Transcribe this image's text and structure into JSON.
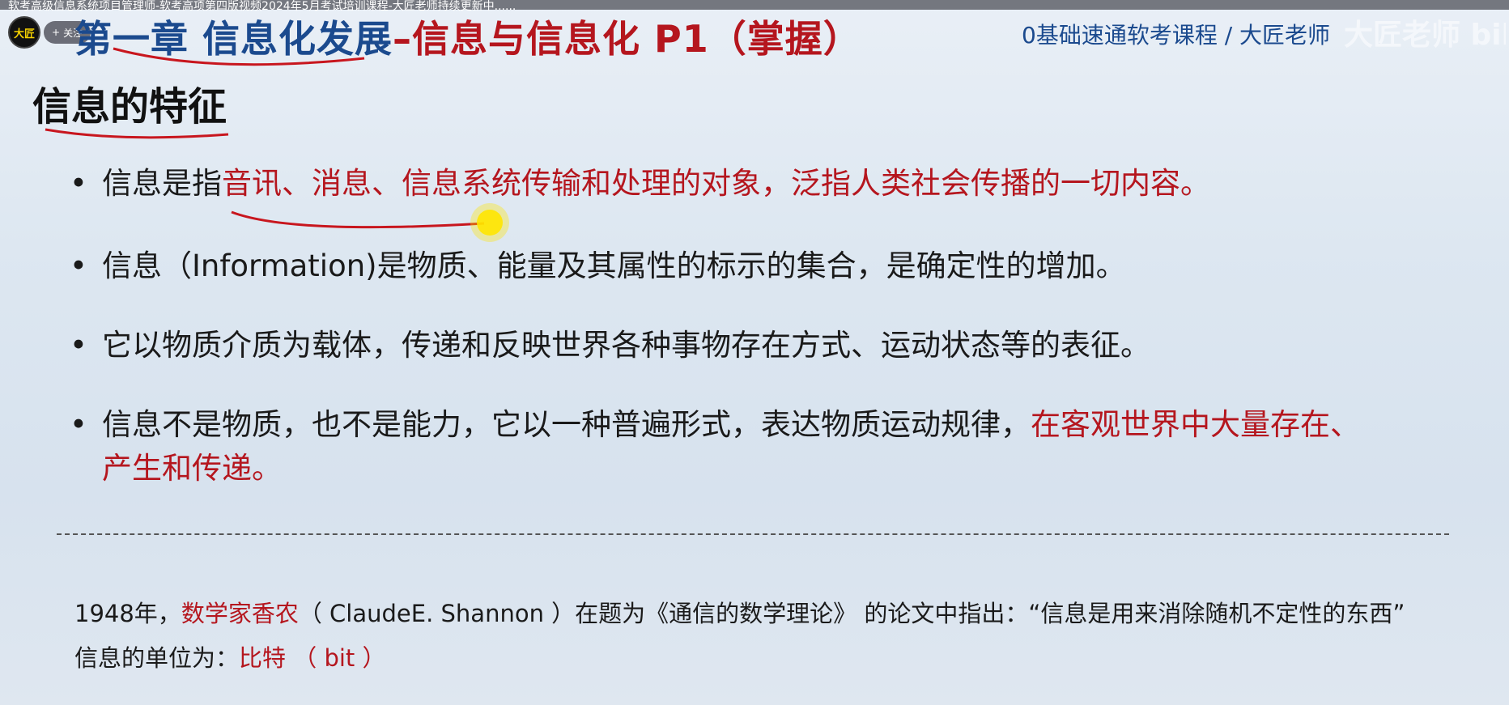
{
  "video": {
    "title": "软考高级信息系统项目管理师-软考高项第四版视频2024年5月考试培训课程-大匠老师持续更新中......",
    "uploader_avatar_text": "大匠",
    "follow_label": "关注",
    "follow_icon": "plus-icon",
    "watermark": "大匠老师 bilibili"
  },
  "slide": {
    "chapter_title_part1": "第一章 信息化发展",
    "chapter_title_part2": "–信息与信息化 P1（掌握）",
    "course_credit": "0基础速通软考课程 / 大匠老师",
    "section_heading": "信息的特征",
    "bullets": [
      {
        "plain": "信息是指",
        "highlight": "音讯、消息、信息系统传输和处理的对象，泛指人类社会传播的一切内容。",
        "tail": ""
      },
      {
        "plain": "信息（Information)是物质、能量及其属性的标示的集合，是确定性的增加。",
        "highlight": "",
        "tail": ""
      },
      {
        "plain": "它以物质介质为载体，传递和反映世界各种事物存在方式、运动状态等的表征。",
        "highlight": "",
        "tail": ""
      },
      {
        "plain": "信息不是物质，也不是能力，它以一种普遍形式，表达物质运动规律，",
        "highlight": "在客观世界中大量存在、",
        "tail": "产生和传递。"
      }
    ],
    "note": {
      "line1_a": "1948年，",
      "line1_b": "数学家香农",
      "line1_c": "（ ClaudeE. Shannon ）在题为《通信的数学理论》 的论文中指出：“信息是用来消除随机不定性的东西”",
      "line2_a": "信息的单位为：",
      "line2_b": "比特 （ bit ）"
    }
  },
  "colors": {
    "title_blue": "#1b4a8e",
    "emphasis_red": "#b5161e",
    "background": "#dde7f1",
    "cursor_highlight": "#ffe600"
  }
}
